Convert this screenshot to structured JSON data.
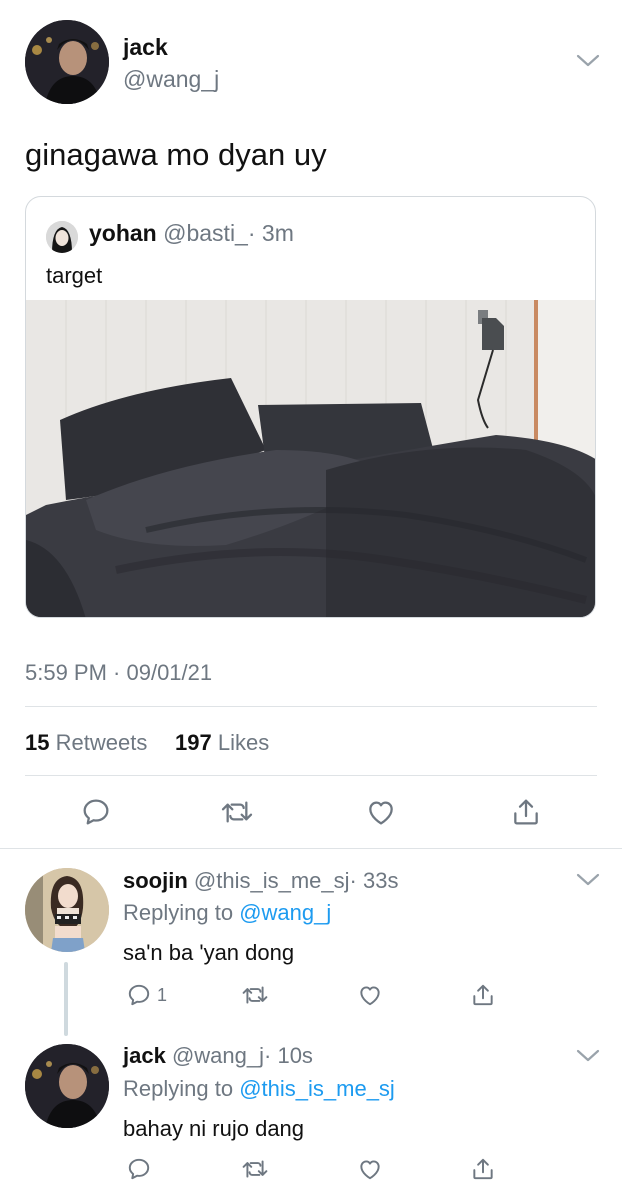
{
  "main_tweet": {
    "author_name": "jack",
    "author_handle": "@wang_j",
    "text": "ginagawa mo dyan uy",
    "timestamp": "5:59 PM · 09/01/21",
    "retweets_count": "15",
    "retweets_label": "Retweets",
    "likes_count": "197",
    "likes_label": "Likes"
  },
  "quoted_tweet": {
    "author_name": "yohan",
    "author_handle": "@basti_",
    "time": "· 3m",
    "text": "target"
  },
  "replies": [
    {
      "author_name": "soojin",
      "author_handle": "@this_is_me_sj",
      "time": "· 33s",
      "replying_prefix": "Replying to",
      "replying_to": "@wang_j",
      "text": "sa'n ba 'yan dong",
      "reply_count": "1"
    },
    {
      "author_name": "jack",
      "author_handle": "@wang_j",
      "time": "· 10s",
      "replying_prefix": "Replying to",
      "replying_to": "@this_is_me_sj",
      "text": "bahay ni rujo dang",
      "reply_count": ""
    }
  ],
  "icons": {
    "reply": "reply-icon",
    "retweet": "retweet-icon",
    "like": "heart-icon",
    "share": "share-icon",
    "menu": "chevron-down-icon"
  },
  "colors": {
    "link": "#1d9bf0",
    "muted": "#6e7781",
    "divider": "#dfe3e6"
  }
}
